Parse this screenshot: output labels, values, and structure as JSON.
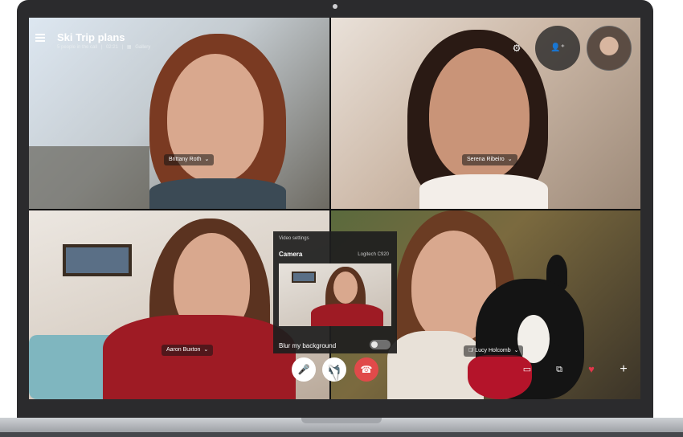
{
  "call": {
    "title": "Ski Trip plans",
    "people_in_call": "5 people in the call",
    "separator1": "|",
    "duration": "02:21",
    "separator2": "|",
    "layout_mode": "Gallery"
  },
  "participants": [
    {
      "name": "Brittany Roth"
    },
    {
      "name": "Serena Ribeiro"
    },
    {
      "name": "Aaron Buxton"
    },
    {
      "name": "Lucy Holcomb"
    }
  ],
  "icons": {
    "menu": "hamburger-menu-icon",
    "gallery": "gallery-grid-icon",
    "settings": "gear-icon",
    "add_people": "add-person-icon",
    "chevron": "chevron-down-icon",
    "mic": "microphone-icon",
    "video": "video-camera-icon",
    "hangup": "hang-up-icon",
    "chat": "chat-bubble-icon",
    "share": "share-screen-icon",
    "react": "heart-icon",
    "more": "plus-icon",
    "mute": "mute-icon"
  },
  "video_settings": {
    "heading": "Video settings",
    "camera_label": "Camera",
    "camera_device": "Logitech C920",
    "blur_label": "Blur my background",
    "blur_enabled": false
  },
  "colors": {
    "hangup": "#e04a4a",
    "heart": "#e2374b",
    "panel_bg": "#1e1e1e",
    "bezel": "#2b2b2d"
  }
}
